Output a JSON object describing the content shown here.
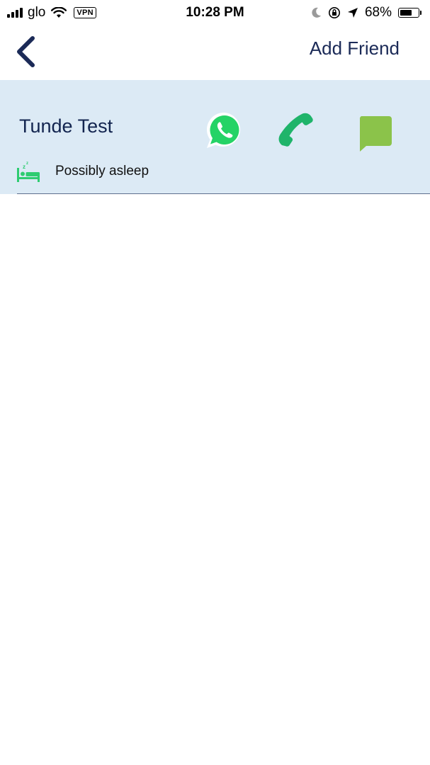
{
  "status_bar": {
    "carrier": "glo",
    "vpn_label": "VPN",
    "time": "10:28 PM",
    "battery_percent_text": "68%",
    "battery_level": 0.68,
    "icons": [
      "signal-icon",
      "wifi-icon",
      "moon-icon",
      "orientation-lock-icon",
      "location-arrow-icon",
      "battery-icon"
    ]
  },
  "nav": {
    "back_icon": "chevron-left-icon",
    "add_friend_label": "Add Friend"
  },
  "friend": {
    "name": "Tunde Test",
    "status_text": "Possibly asleep",
    "actions": [
      "whatsapp-icon",
      "phone-icon",
      "message-icon"
    ],
    "status_icon": "sleeping-bed-icon"
  },
  "colors": {
    "accent_navy": "#1b2a57",
    "card_background": "#dceaf5",
    "whatsapp_green": "#25d366",
    "call_green": "#1fb46a",
    "message_green": "#8bc34a",
    "sleep_green": "#2ecc71"
  }
}
